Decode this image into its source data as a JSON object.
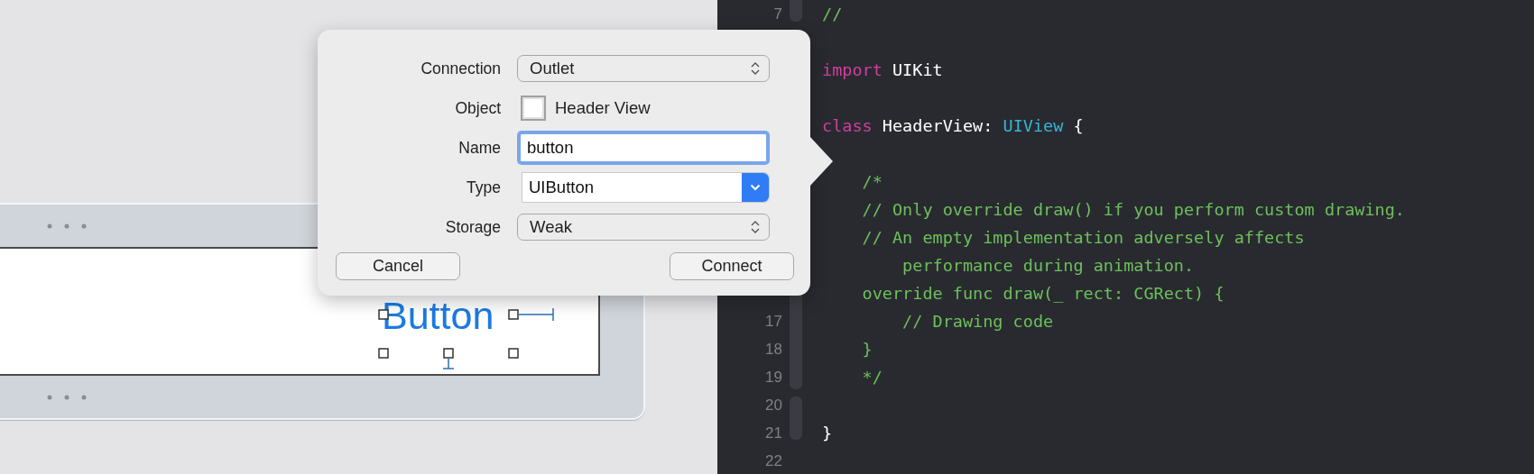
{
  "canvas": {
    "button_label": "Button"
  },
  "popover": {
    "fields": [
      {
        "label": "Connection",
        "kind": "popup",
        "value": "Outlet"
      },
      {
        "label": "Object",
        "kind": "object",
        "value": "Header View"
      },
      {
        "label": "Name",
        "kind": "text",
        "value": "button"
      },
      {
        "label": "Type",
        "kind": "combo",
        "value": "UIButton"
      },
      {
        "label": "Storage",
        "kind": "popup",
        "value": "Weak"
      }
    ],
    "buttons": [
      "Cancel",
      "Connect"
    ]
  },
  "editor": {
    "lines": [
      {
        "number": "7",
        "tokens": [
          {
            "kind": "comment",
            "text": "//"
          }
        ]
      },
      {
        "space_before": true,
        "tokens": [
          {
            "kind": "keyword",
            "text": "import"
          },
          {
            "kind": "plain",
            "text": " UIKit"
          }
        ]
      },
      {
        "space_before": true,
        "tokens": [
          {
            "kind": "keyword",
            "text": "class"
          },
          {
            "kind": "plain",
            "text": " HeaderView: "
          },
          {
            "kind": "type",
            "text": "UIView"
          },
          {
            "kind": "plain",
            "text": " {"
          }
        ]
      },
      {
        "space_before": true,
        "tokens": [
          {
            "kind": "comment",
            "text": "    /*"
          }
        ]
      },
      {
        "tokens": [
          {
            "kind": "comment",
            "text": "    // Only override draw() if you perform custom drawing."
          }
        ]
      },
      {
        "tokens": [
          {
            "kind": "comment",
            "text": "    // An empty implementation adversely affects"
          }
        ]
      },
      {
        "tokens": [
          {
            "kind": "comment",
            "text": "        performance during animation."
          }
        ]
      },
      {
        "tokens": [
          {
            "kind": "comment",
            "text": "    override func draw(_ rect: CGRect) {"
          }
        ]
      },
      {
        "number": "17",
        "tokens": [
          {
            "kind": "comment",
            "text": "        // Drawing code"
          }
        ]
      },
      {
        "number": "18",
        "tokens": [
          {
            "kind": "comment",
            "text": "    }"
          }
        ]
      },
      {
        "number": "19",
        "tokens": [
          {
            "kind": "comment",
            "text": "    */"
          }
        ]
      },
      {
        "number": "20"
      },
      {
        "number": "21",
        "tokens": [
          {
            "kind": "plain",
            "text": "}"
          }
        ]
      },
      {
        "number": "22"
      }
    ]
  }
}
